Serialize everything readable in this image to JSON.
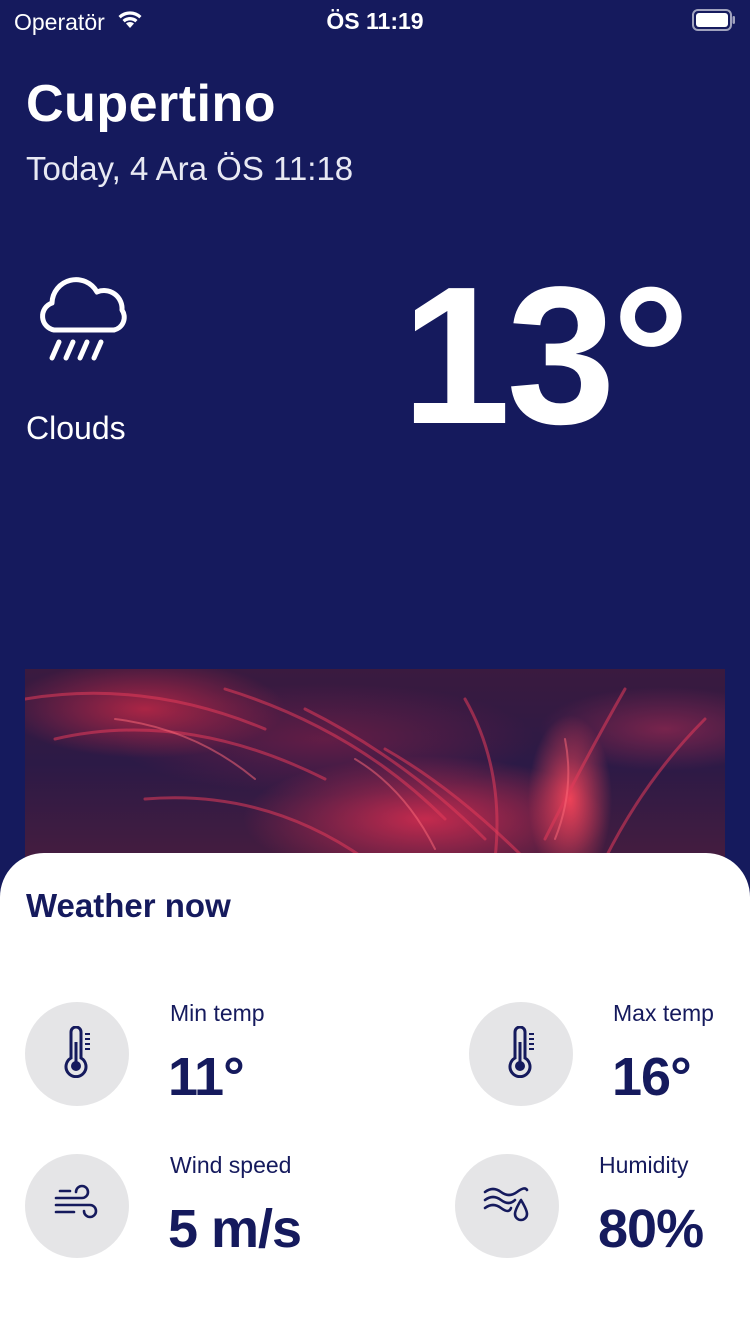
{
  "status_bar": {
    "carrier": "Operatör",
    "time": "ÖS 11:19"
  },
  "header": {
    "city": "Cupertino",
    "date": "Today, 4 Ara ÖS 11:18"
  },
  "current": {
    "condition_icon": "cloud-rain-icon",
    "condition": "Clouds",
    "temperature": "13°"
  },
  "details": {
    "title": "Weather now",
    "min_temp": {
      "label": "Min temp",
      "value": "11°",
      "icon": "thermometer-icon"
    },
    "max_temp": {
      "label": "Max temp",
      "value": "16°",
      "icon": "thermometer-icon"
    },
    "wind_speed": {
      "label": "Wind speed",
      "value": "5 m/s",
      "icon": "wind-icon"
    },
    "humidity": {
      "label": "Humidity",
      "value": "80%",
      "icon": "humidity-icon"
    }
  },
  "colors": {
    "background": "#151a5d",
    "sheet": "#ffffff",
    "icon_circle": "#e5e5e7",
    "text_dark": "#151a5d"
  }
}
